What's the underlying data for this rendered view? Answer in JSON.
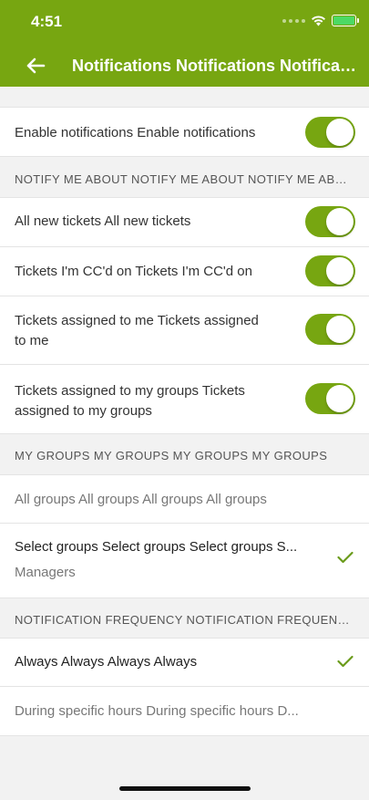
{
  "status_bar": {
    "time": "4:51"
  },
  "app_bar": {
    "title": "Notifications Notifications Notificatio..."
  },
  "enable_row": {
    "label": "Enable notifications Enable notifications",
    "enabled": true
  },
  "notify_section": {
    "header": "NOTIFY ME ABOUT NOTIFY ME ABOUT NOTIFY ME ABO...",
    "items": [
      {
        "label": "All new tickets All new tickets",
        "enabled": true
      },
      {
        "label": "Tickets I'm CC'd on Tickets I'm CC'd on",
        "enabled": true
      },
      {
        "label_line1": "Tickets assigned to me Tickets assigned",
        "label_line2": "to me",
        "enabled": true
      },
      {
        "label_line1": "Tickets assigned to my groups Tickets",
        "label_line2": "assigned to my groups",
        "enabled": true
      }
    ]
  },
  "groups_section": {
    "header": "MY GROUPS MY GROUPS MY GROUPS MY GROUPS",
    "all_groups": "All groups All groups All groups All groups",
    "select_groups": "Select groups Select groups Select groups S...",
    "selected_value": "Managers"
  },
  "frequency_section": {
    "header": "NOTIFICATION FREQUENCY NOTIFICATION FREQUENC...",
    "always": "Always Always Always Always",
    "specific_hours": "During specific hours During specific hours D..."
  },
  "colors": {
    "accent": "#77a611",
    "checkmark": "#6a9b1a"
  }
}
